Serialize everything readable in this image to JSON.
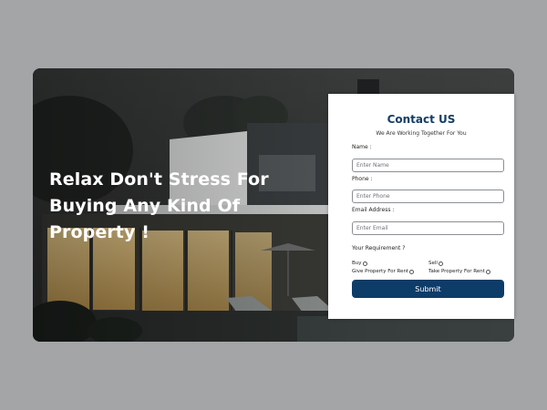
{
  "hero": {
    "headline": "Relax Don't Stress For Buying Any Kind Of Property !"
  },
  "contact_form": {
    "title": "Contact US",
    "subtitle": "We Are Working Together For You",
    "name_label": "Name :",
    "name_placeholder": "Enter Name",
    "phone_label": "Phone :",
    "phone_placeholder": "Enter Phone",
    "email_label": "Email Address :",
    "email_placeholder": "Enter Email",
    "requirement_label": "Your Requirement ?",
    "options": [
      "Buy",
      "Sell",
      "Give Property For Rent",
      "Take Property For Rent"
    ],
    "submit_label": "Submit"
  },
  "colors": {
    "page_background": "#a3a5a7",
    "brand_navy": "#0e3c69",
    "title_blue": "#143e66"
  },
  "icons": {
    "hero_image": "house-photo"
  }
}
